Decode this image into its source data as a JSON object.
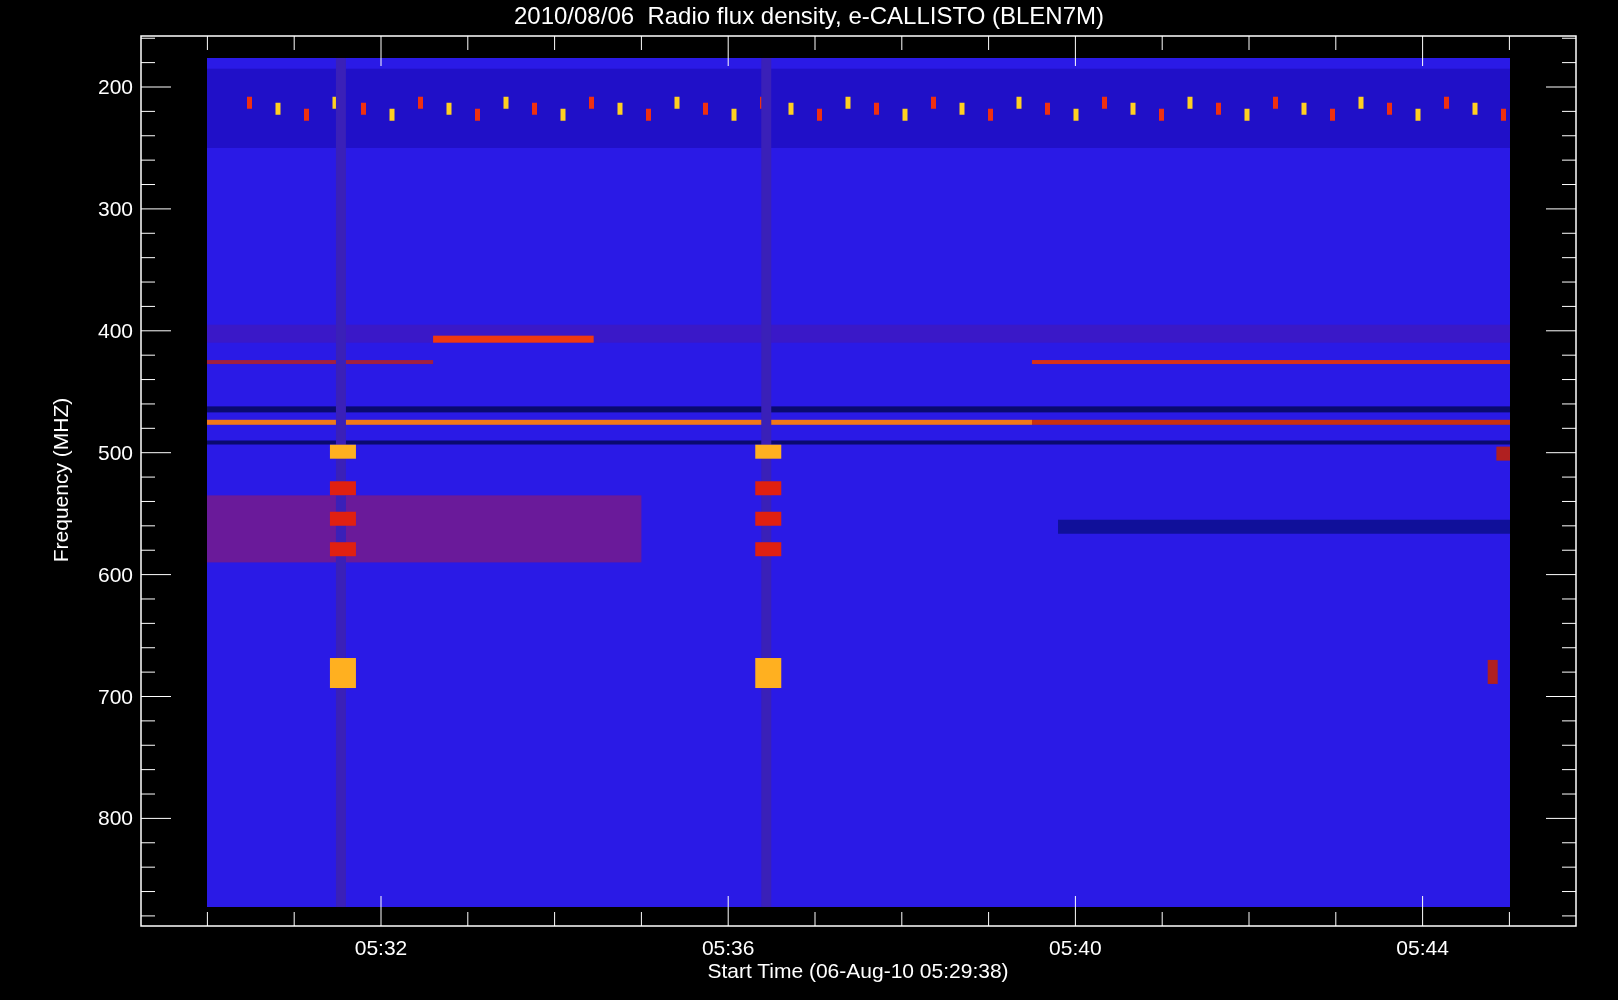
{
  "plot": {
    "title": "2010/08/06  Radio flux density, e-CALLISTO (BLEN7M)",
    "ylabel": "Frequency (MHZ)",
    "xlabel": "Start Time (06-Aug-10 05:29:38)",
    "yticks": [
      "200",
      "300",
      "400",
      "500",
      "600",
      "700",
      "800"
    ],
    "xticks": [
      "05:32",
      "05:36",
      "05:40",
      "05:44"
    ]
  }
}
